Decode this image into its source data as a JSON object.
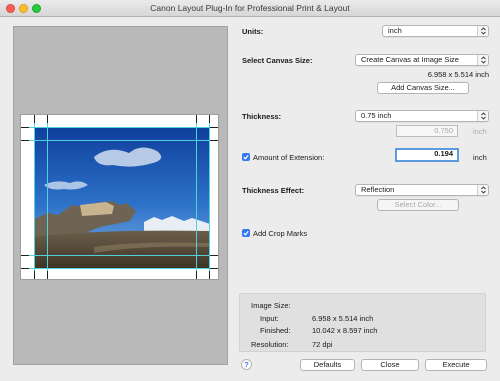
{
  "window": {
    "title": "Canon Layout Plug-In for Professional Print & Layout"
  },
  "units": {
    "label": "Units:",
    "value": "inch"
  },
  "canvas": {
    "label": "Select Canvas Size:",
    "value": "Create Canvas at Image Size",
    "size_text": "6.958 x 5.514 inch",
    "add_button": "Add Canvas Size..."
  },
  "thickness": {
    "label": "Thickness:",
    "value": "0.75 inch",
    "custom_value": "0.750",
    "unit": "inch"
  },
  "extension": {
    "label": "Amount of Extension:",
    "checked": true,
    "value": "0.194",
    "unit": "inch"
  },
  "effect": {
    "label": "Thickness Effect:",
    "value": "Reflection",
    "select_color_button": "Select Color..."
  },
  "crop_marks": {
    "label": "Add Crop Marks",
    "checked": true
  },
  "image_size": {
    "heading": "Image Size:",
    "input_label": "Input:",
    "input_value": "6.958 x 5.514 inch",
    "finished_label": "Finished:",
    "finished_value": "10.042 x 8.597 inch",
    "resolution_label": "Resolution:",
    "resolution_value": "72 dpi"
  },
  "buttons": {
    "help": "?",
    "defaults": "Defaults",
    "close": "Close",
    "execute": "Execute"
  },
  "colors": {
    "accent": "#3478f6",
    "guide": "#4fd1de",
    "preview_bg": "#b9b9b9"
  }
}
